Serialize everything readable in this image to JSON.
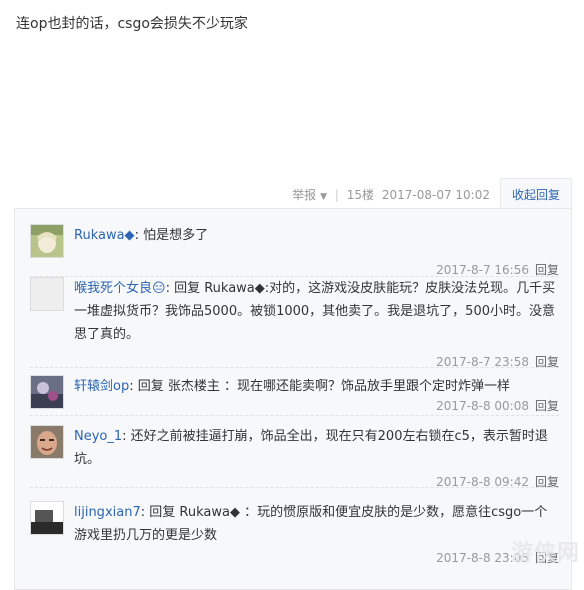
{
  "post": {
    "text": "连op也封的话，csgo会损失不少玩家",
    "meta": {
      "report": "举报",
      "floor": "15楼",
      "datetime": "2017-08-07 10:02"
    },
    "collapse_label": "收起回复"
  },
  "replies": [
    {
      "user": "Rukawa◆",
      "reply_prefix": "",
      "reply_to": "",
      "text": ": 怕是想多了",
      "time": "2017-8-7 16:56",
      "reply_label": "回复"
    },
    {
      "user": "喉我死个女良😑",
      "reply_prefix": ": 回复",
      "reply_to": "Rukawa◆",
      "text": ":对的，这游戏没皮肤能玩？皮肤没法兑现。几千买一堆虚拟货币？我饰品5000。被锁1000，其他卖了。我是退坑了，500小时。没意思了真的。",
      "time": "2017-8-7 23:58",
      "reply_label": "回复"
    },
    {
      "user": "轩辕剑op",
      "reply_prefix": ": 回复",
      "reply_to": "张杰楼主",
      "text": " ：现在哪还能卖啊？饰品放手里跟个定时炸弹一样",
      "time": "2017-8-8 00:08",
      "reply_label": "回复"
    },
    {
      "user": "Neyo_1",
      "reply_prefix": "",
      "reply_to": "",
      "text": ": 还好之前被挂逼打崩，饰品全出，现在只有200左右锁在c5，表示暂时退坑。",
      "time": "2017-8-8 09:42",
      "reply_label": "回复"
    },
    {
      "user": "lijingxian7",
      "reply_prefix": ": 回复",
      "reply_to": "Rukawa◆",
      "text": " ：玩的惯原版和便宜皮肤的是少数，愿意往csgo一个游戏里扔几万的更是少数",
      "time": "2017-8-8 23:05",
      "reply_label": "回复"
    }
  ],
  "watermark": "游侠网"
}
